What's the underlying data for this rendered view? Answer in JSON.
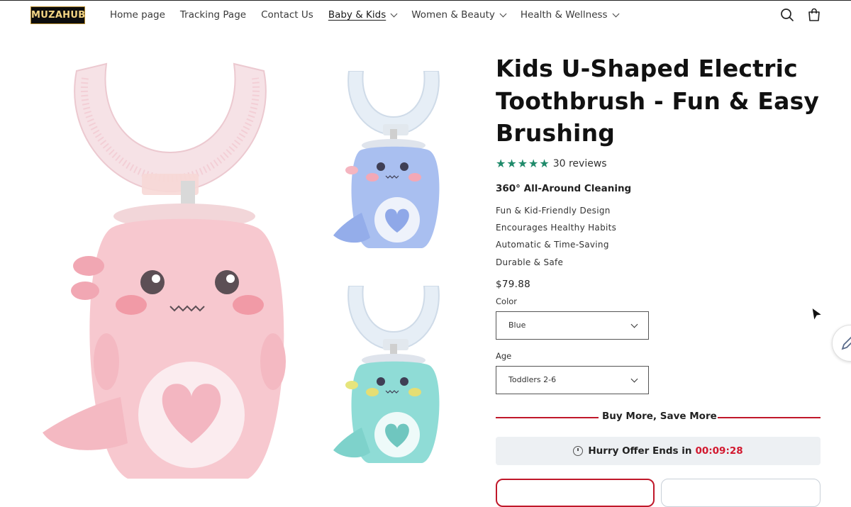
{
  "header": {
    "logo_text": "MUZAHUB",
    "nav": [
      {
        "label": "Home page",
        "dropdown": false,
        "active": false
      },
      {
        "label": "Tracking Page",
        "dropdown": false,
        "active": false
      },
      {
        "label": "Contact Us",
        "dropdown": false,
        "active": false
      },
      {
        "label": "Baby & Kids",
        "dropdown": true,
        "active": true
      },
      {
        "label": "Women & Beauty",
        "dropdown": true,
        "active": false
      },
      {
        "label": "Health & Wellness",
        "dropdown": true,
        "active": false
      }
    ],
    "icons": [
      "search-icon",
      "cart-icon"
    ]
  },
  "product": {
    "title": "Kids U-Shaped Electric Toothbrush - Fun & Easy Brushing",
    "rating_stars": 5,
    "reviews": "30 reviews",
    "headline_feature": "360° All-Around Cleaning",
    "features": [
      "Fun & Kid-Friendly Design",
      "Encourages Healthy Habits",
      "Automatic & Time-Saving",
      "Durable & Safe"
    ],
    "price": "$79.88",
    "color_label": "Color",
    "color_value": "Blue",
    "age_label": "Age",
    "age_value": "Toddlers 2-6",
    "bundle_heading": "Buy More, Save More",
    "offer_text": "Hurry Offer Ends in",
    "offer_timer": "00:09:28"
  },
  "colors": {
    "accent_red": "#c0182a",
    "star_green": "#1f8a6a",
    "timer_red": "#d2192f"
  }
}
